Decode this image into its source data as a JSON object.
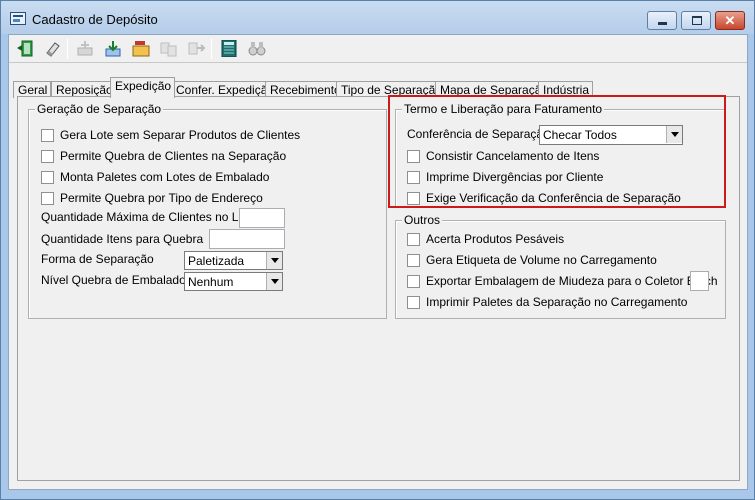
{
  "window": {
    "title": "Cadastro de Depósito"
  },
  "toolbar": {
    "buttons": [
      {
        "name": "exit-icon",
        "color": "#1a7d2e"
      },
      {
        "name": "eraser-icon",
        "color": "#7a7a7a"
      },
      {
        "name": "new-record-icon",
        "color": "#bdbdbd"
      },
      {
        "name": "save-icon",
        "color": "#2c64b0"
      },
      {
        "name": "open-folder-icon",
        "color": "#c0392b"
      },
      {
        "name": "copy-icon",
        "color": "#bdbdbd"
      },
      {
        "name": "move-icon",
        "color": "#bdbdbd"
      },
      {
        "name": "calculator-icon",
        "color": "#1f6f6f"
      },
      {
        "name": "binoculars-icon",
        "color": "#9a9a9a"
      }
    ]
  },
  "tabs": [
    "Geral",
    "Reposição",
    "Expedição",
    "Confer. Expedição",
    "Recebimento",
    "Tipo de Separação",
    "Mapa de Separação",
    "Indústria"
  ],
  "active_tab": "Expedição",
  "geracao": {
    "legend": "Geração de Separação",
    "checkboxes": [
      {
        "label": "Gera Lote sem Separar Produtos de Clientes",
        "checked": false
      },
      {
        "label": "Permite Quebra de Clientes na Separação",
        "checked": false
      },
      {
        "label": "Monta Paletes com Lotes de Embalado",
        "checked": false
      },
      {
        "label": "Permite Quebra por Tipo de Endereço",
        "checked": false
      }
    ],
    "qtd_max_clientes_label": "Quantidade Máxima de Clientes no Lote",
    "qtd_itens_label": "Quantidade Itens para Quebra",
    "forma_label": "Forma de Separação",
    "forma_value": "Paletizada",
    "nivel_label": "Nível Quebra de Embalados",
    "nivel_value": "Nenhum"
  },
  "termo": {
    "legend": "Termo e Liberação para Faturamento",
    "conferencia_label": "Conferência de Separação",
    "conferencia_value": "Checar Todos",
    "checkboxes": [
      {
        "label": "Consistir Cancelamento de Itens",
        "checked": false
      },
      {
        "label": "Imprime Divergências por Cliente",
        "checked": false
      },
      {
        "label": "Exige Verificação da Conferência de Separação",
        "checked": false
      }
    ],
    "highlight_color": "#cc1a1a"
  },
  "outros": {
    "legend": "Outros",
    "checkboxes": [
      {
        "label": "Acerta Produtos Pesáveis",
        "checked": false
      },
      {
        "label": "Gera Etiqueta de Volume no Carregamento",
        "checked": false
      },
      {
        "label": "Exportar Embalagem de Miudeza para o Coletor Batch",
        "checked": false
      },
      {
        "label": "Imprimir Paletes da Separação no Carregamento",
        "checked": false
      }
    ]
  }
}
